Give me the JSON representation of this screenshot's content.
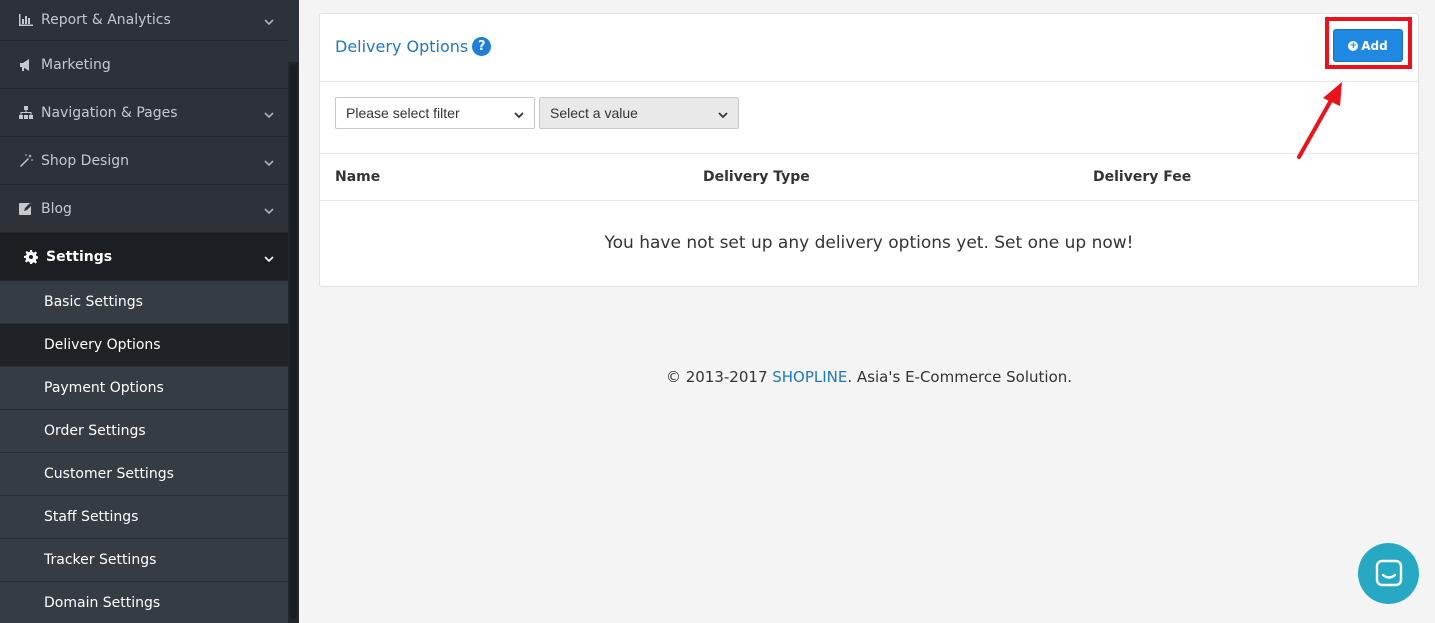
{
  "sidebar": {
    "items": [
      {
        "label": "Report & Analytics",
        "icon": "bar-chart-icon",
        "has_chevron": true
      },
      {
        "label": "Marketing",
        "icon": "megaphone-icon",
        "has_chevron": false
      },
      {
        "label": "Navigation & Pages",
        "icon": "sitemap-icon",
        "has_chevron": true
      },
      {
        "label": "Shop Design",
        "icon": "magic-wand-icon",
        "has_chevron": true
      },
      {
        "label": "Blog",
        "icon": "edit-icon",
        "has_chevron": true
      },
      {
        "label": "Settings",
        "icon": "gear-icon",
        "has_chevron": true,
        "active": true
      }
    ],
    "sub_items": [
      {
        "label": "Basic Settings"
      },
      {
        "label": "Delivery Options",
        "current": true
      },
      {
        "label": "Payment Options"
      },
      {
        "label": "Order Settings"
      },
      {
        "label": "Customer Settings"
      },
      {
        "label": "Staff Settings"
      },
      {
        "label": "Tracker Settings"
      },
      {
        "label": "Domain Settings"
      }
    ]
  },
  "main": {
    "title": "Delivery Options",
    "help_glyph": "?",
    "add_label": "Add",
    "filter_placeholder": "Please select filter",
    "value_placeholder": "Select a value",
    "columns": [
      "Name",
      "Delivery Type",
      "Delivery Fee"
    ],
    "empty_message": "You have not set up any delivery options yet. Set one up now!"
  },
  "footer": {
    "prefix": "© 2013-2017 ",
    "brand": "SHOPLINE",
    "suffix": ". Asia's E-Commerce Solution."
  },
  "colors": {
    "accent": "#1f88e0",
    "link": "#2277bb",
    "highlight": "#e8131b",
    "chat": "#27a9c4"
  }
}
